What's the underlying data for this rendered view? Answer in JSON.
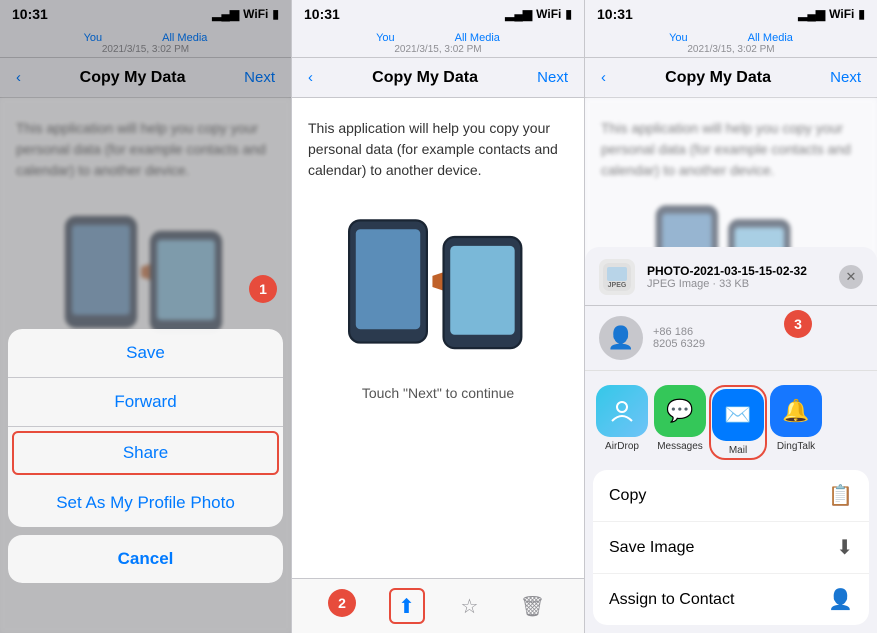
{
  "panels": [
    {
      "id": "panel-1",
      "status": {
        "time": "10:31",
        "signal": "▂▄▆",
        "wifi": "WiFi",
        "battery": "🔋"
      },
      "contact": {
        "you": "You",
        "allMedia": "All Media",
        "datetime": "2021/3/15, 3:02 PM"
      },
      "nav": {
        "title": "Copy My Data",
        "next": "Next"
      },
      "description": "This application will help you copy your personal data (for example contacts and calendar) to another device.",
      "actionSheet": {
        "items": [
          "Save",
          "Forward",
          "Share",
          "Set As My Profile Photo"
        ],
        "cancel": "Cancel"
      },
      "stepBadge": "1"
    },
    {
      "id": "panel-2",
      "status": {
        "time": "10:31"
      },
      "contact": {
        "you": "You",
        "allMedia": "All Media",
        "datetime": "2021/3/15, 3:02 PM"
      },
      "nav": {
        "title": "Copy My Data",
        "next": "Next"
      },
      "description": "This application will help you copy your personal data (for example contacts and calendar) to another device.",
      "touchNext": "Touch \"Next\" to continue",
      "stepBadge": "2"
    },
    {
      "id": "panel-3",
      "status": {
        "time": "10:31"
      },
      "contact": {
        "you": "You",
        "allMedia": "All Media",
        "datetime": "2021/3/15, 3:02 PM"
      },
      "nav": {
        "title": "Copy My Data",
        "next": "Next"
      },
      "description": "This application will help you copy your personal data (for example contacts and calendar) to another device.",
      "shareSheet": {
        "filename": "PHOTO-2021-03-15-15-02-32",
        "filetype": "JPEG Image · 33 KB",
        "apps": [
          {
            "name": "AirDrop",
            "type": "airdrop"
          },
          {
            "name": "Messages",
            "type": "messages"
          },
          {
            "name": "Mail",
            "type": "mail"
          },
          {
            "name": "DingTalk",
            "type": "dingtalk"
          }
        ],
        "actions": [
          {
            "label": "Copy",
            "icon": "📋"
          },
          {
            "label": "Save Image",
            "icon": "⬇"
          },
          {
            "label": "Assign to Contact",
            "icon": "👤"
          }
        ]
      },
      "stepBadge": "3"
    }
  ],
  "icons": {
    "back_chevron": "‹",
    "close": "✕",
    "share": "⬆",
    "draw": "✏",
    "star": "☆",
    "trash": "🗑",
    "copy_file": "📋",
    "save_image": "⬇",
    "person": "👤"
  }
}
